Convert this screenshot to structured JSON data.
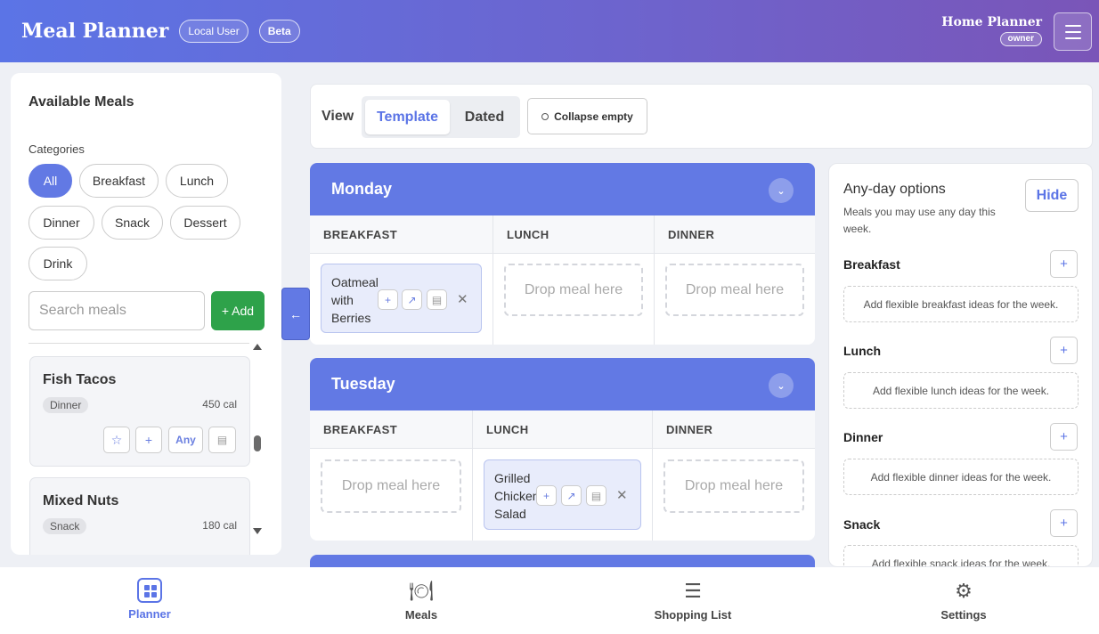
{
  "header": {
    "title": "Meal Planner",
    "user_badge": "Local User",
    "beta_badge": "Beta",
    "planner_name": "Home Planner",
    "role": "owner"
  },
  "sidebar": {
    "title": "Available Meals",
    "categories_label": "Categories",
    "categories": [
      "All",
      "Breakfast",
      "Lunch",
      "Dinner",
      "Snack",
      "Dessert",
      "Drink"
    ],
    "active_category": "All",
    "search_placeholder": "Search meals",
    "add_label": "+ Add",
    "meals": [
      {
        "name": "Fish Tacos",
        "category": "Dinner",
        "calories": "450 cal",
        "any_label": "Any"
      },
      {
        "name": "Mixed Nuts",
        "category": "Snack",
        "calories": "180 cal"
      }
    ]
  },
  "collapse_arrow": "←",
  "view": {
    "label": "View",
    "tabs": [
      "Template",
      "Dated"
    ],
    "active_tab": "Template",
    "collapse_empty": "Collapse empty"
  },
  "days": [
    {
      "name": "Monday",
      "columns": [
        "BREAKFAST",
        "LUNCH",
        "DINNER"
      ],
      "slots": [
        {
          "meal": "Oatmeal with Berries"
        },
        {
          "placeholder": "Drop meal here"
        },
        {
          "placeholder": "Drop meal here"
        }
      ]
    },
    {
      "name": "Tuesday",
      "columns": [
        "BREAKFAST",
        "LUNCH",
        "DINNER"
      ],
      "slots": [
        {
          "placeholder": "Drop meal here"
        },
        {
          "meal": "Grilled Chicken Salad"
        },
        {
          "placeholder": "Drop meal here"
        }
      ]
    }
  ],
  "any_day": {
    "title": "Any-day options",
    "subtitle": "Meals you may use any day this week.",
    "hide_label": "Hide",
    "sections": [
      {
        "name": "Breakfast",
        "hint": "Add flexible breakfast ideas for the week."
      },
      {
        "name": "Lunch",
        "hint": "Add flexible lunch ideas for the week."
      },
      {
        "name": "Dinner",
        "hint": "Add flexible dinner ideas for the week."
      },
      {
        "name": "Snack",
        "hint": "Add flexible snack ideas for the week."
      }
    ]
  },
  "bottom_nav": [
    {
      "label": "Planner",
      "icon": "calendar-grid-icon",
      "active": true
    },
    {
      "label": "Meals",
      "icon": "utensils-icon"
    },
    {
      "label": "Shopping List",
      "icon": "list-icon"
    },
    {
      "label": "Settings",
      "icon": "gear-icon"
    }
  ],
  "colors": {
    "accent": "#6279e4",
    "add_green": "#2ea24a",
    "header_gradient_start": "#5b74e6",
    "header_gradient_end": "#7a55b8"
  }
}
